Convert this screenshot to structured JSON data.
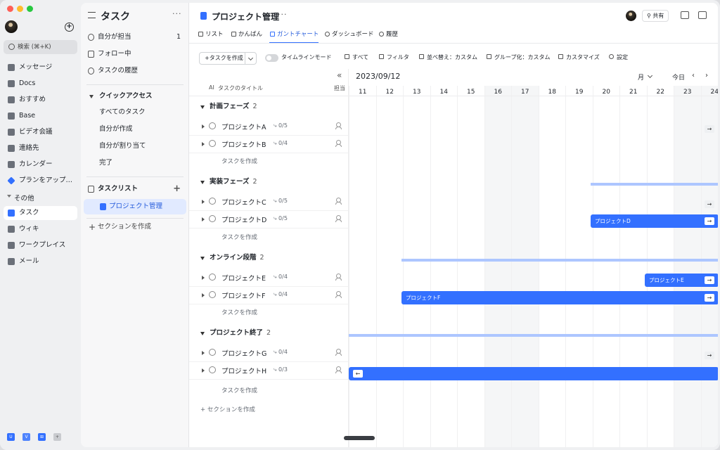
{
  "nav": {
    "search_label": "検索 (⌘+K)",
    "items": [
      {
        "label": "メッセージ",
        "icon": "chat-icon"
      },
      {
        "label": "Docs",
        "icon": "docs-icon"
      },
      {
        "label": "おすすめ",
        "icon": "recommend-icon"
      },
      {
        "label": "Base",
        "icon": "base-icon"
      },
      {
        "label": "ビデオ会議",
        "icon": "video-icon"
      },
      {
        "label": "連絡先",
        "icon": "contacts-icon"
      },
      {
        "label": "カレンダー",
        "icon": "calendar-icon"
      },
      {
        "label": "プランをアップ…",
        "icon": "diamond-icon"
      }
    ],
    "other_label": "その他",
    "sub_items": [
      {
        "label": "タスク",
        "icon": "task-icon",
        "active": true
      },
      {
        "label": "ウィキ",
        "icon": "wiki-icon"
      },
      {
        "label": "ワークプレイス",
        "icon": "workplace-icon"
      },
      {
        "label": "メール",
        "icon": "mail-icon"
      }
    ],
    "dock": [
      "U",
      "V",
      "⊞",
      "+"
    ]
  },
  "sidebar": {
    "title": "タスク",
    "mine_label": "自分が担当",
    "mine_count": "1",
    "follow_label": "フォロー中",
    "history_label": "タスクの履歴",
    "quick_access_label": "クイックアクセス",
    "quick_items": [
      "すべてのタスク",
      "自分が作成",
      "自分が割り当て",
      "完了"
    ],
    "tasklist_label": "タスクリスト",
    "tasklist_active": "プロジェクト管理",
    "create_section": "セクションを作成"
  },
  "header": {
    "title": "プロジェクト管理",
    "share_label": "共有",
    "tabs": [
      {
        "label": "リスト"
      },
      {
        "label": "かんばん"
      },
      {
        "label": "ガントチャート",
        "active": true
      },
      {
        "label": "ダッシュボード"
      },
      {
        "label": "履歴"
      }
    ]
  },
  "toolbar": {
    "create_task": "タスクを作成",
    "timeline_mode": "タイムラインモード",
    "all": "すべて",
    "filter": "フィルタ",
    "sort": "並べ替え：カスタム",
    "group": "グループ化：カスタム",
    "customize": "カスタマイズ",
    "settings": "設定"
  },
  "list": {
    "title_header": "タスクのタイトル",
    "ai_label": "AI",
    "assignee_header": "担当",
    "create_task_label": "タスクを作成",
    "add_section": "セクションを作成",
    "groups": [
      {
        "name": "計画フェーズ",
        "count": "2",
        "tasks": [
          {
            "name": "プロジェクトA",
            "sub": "0/5"
          },
          {
            "name": "プロジェクトB",
            "sub": "0/4"
          }
        ]
      },
      {
        "name": "実装フェーズ",
        "count": "2",
        "tasks": [
          {
            "name": "プロジェクトC",
            "sub": "0/5"
          },
          {
            "name": "プロジェクトD",
            "sub": "0/5"
          }
        ]
      },
      {
        "name": "オンライン段階",
        "count": "2",
        "tasks": [
          {
            "name": "プロジェクトE",
            "sub": "0/4"
          },
          {
            "name": "プロジェクトF",
            "sub": "0/4"
          }
        ]
      },
      {
        "name": "プロジェクト終了",
        "count": "2",
        "tasks": [
          {
            "name": "プロジェクトG",
            "sub": "0/4"
          },
          {
            "name": "プロジェクトH",
            "sub": "0/3"
          }
        ]
      }
    ]
  },
  "gantt": {
    "month_label": "2023/09/12",
    "zoom": "月",
    "today": "今日",
    "days": [
      "11",
      "12",
      "13",
      "14",
      "15",
      "16",
      "17",
      "18",
      "19",
      "20",
      "21",
      "22",
      "23",
      "24"
    ],
    "bar_labels": {
      "D": "プロジェクトD",
      "E": "プロジェクトE",
      "F": "プロジェクトF"
    },
    "colors": {
      "bar": "#3370ff",
      "group_bar": "#adc6ff"
    }
  }
}
